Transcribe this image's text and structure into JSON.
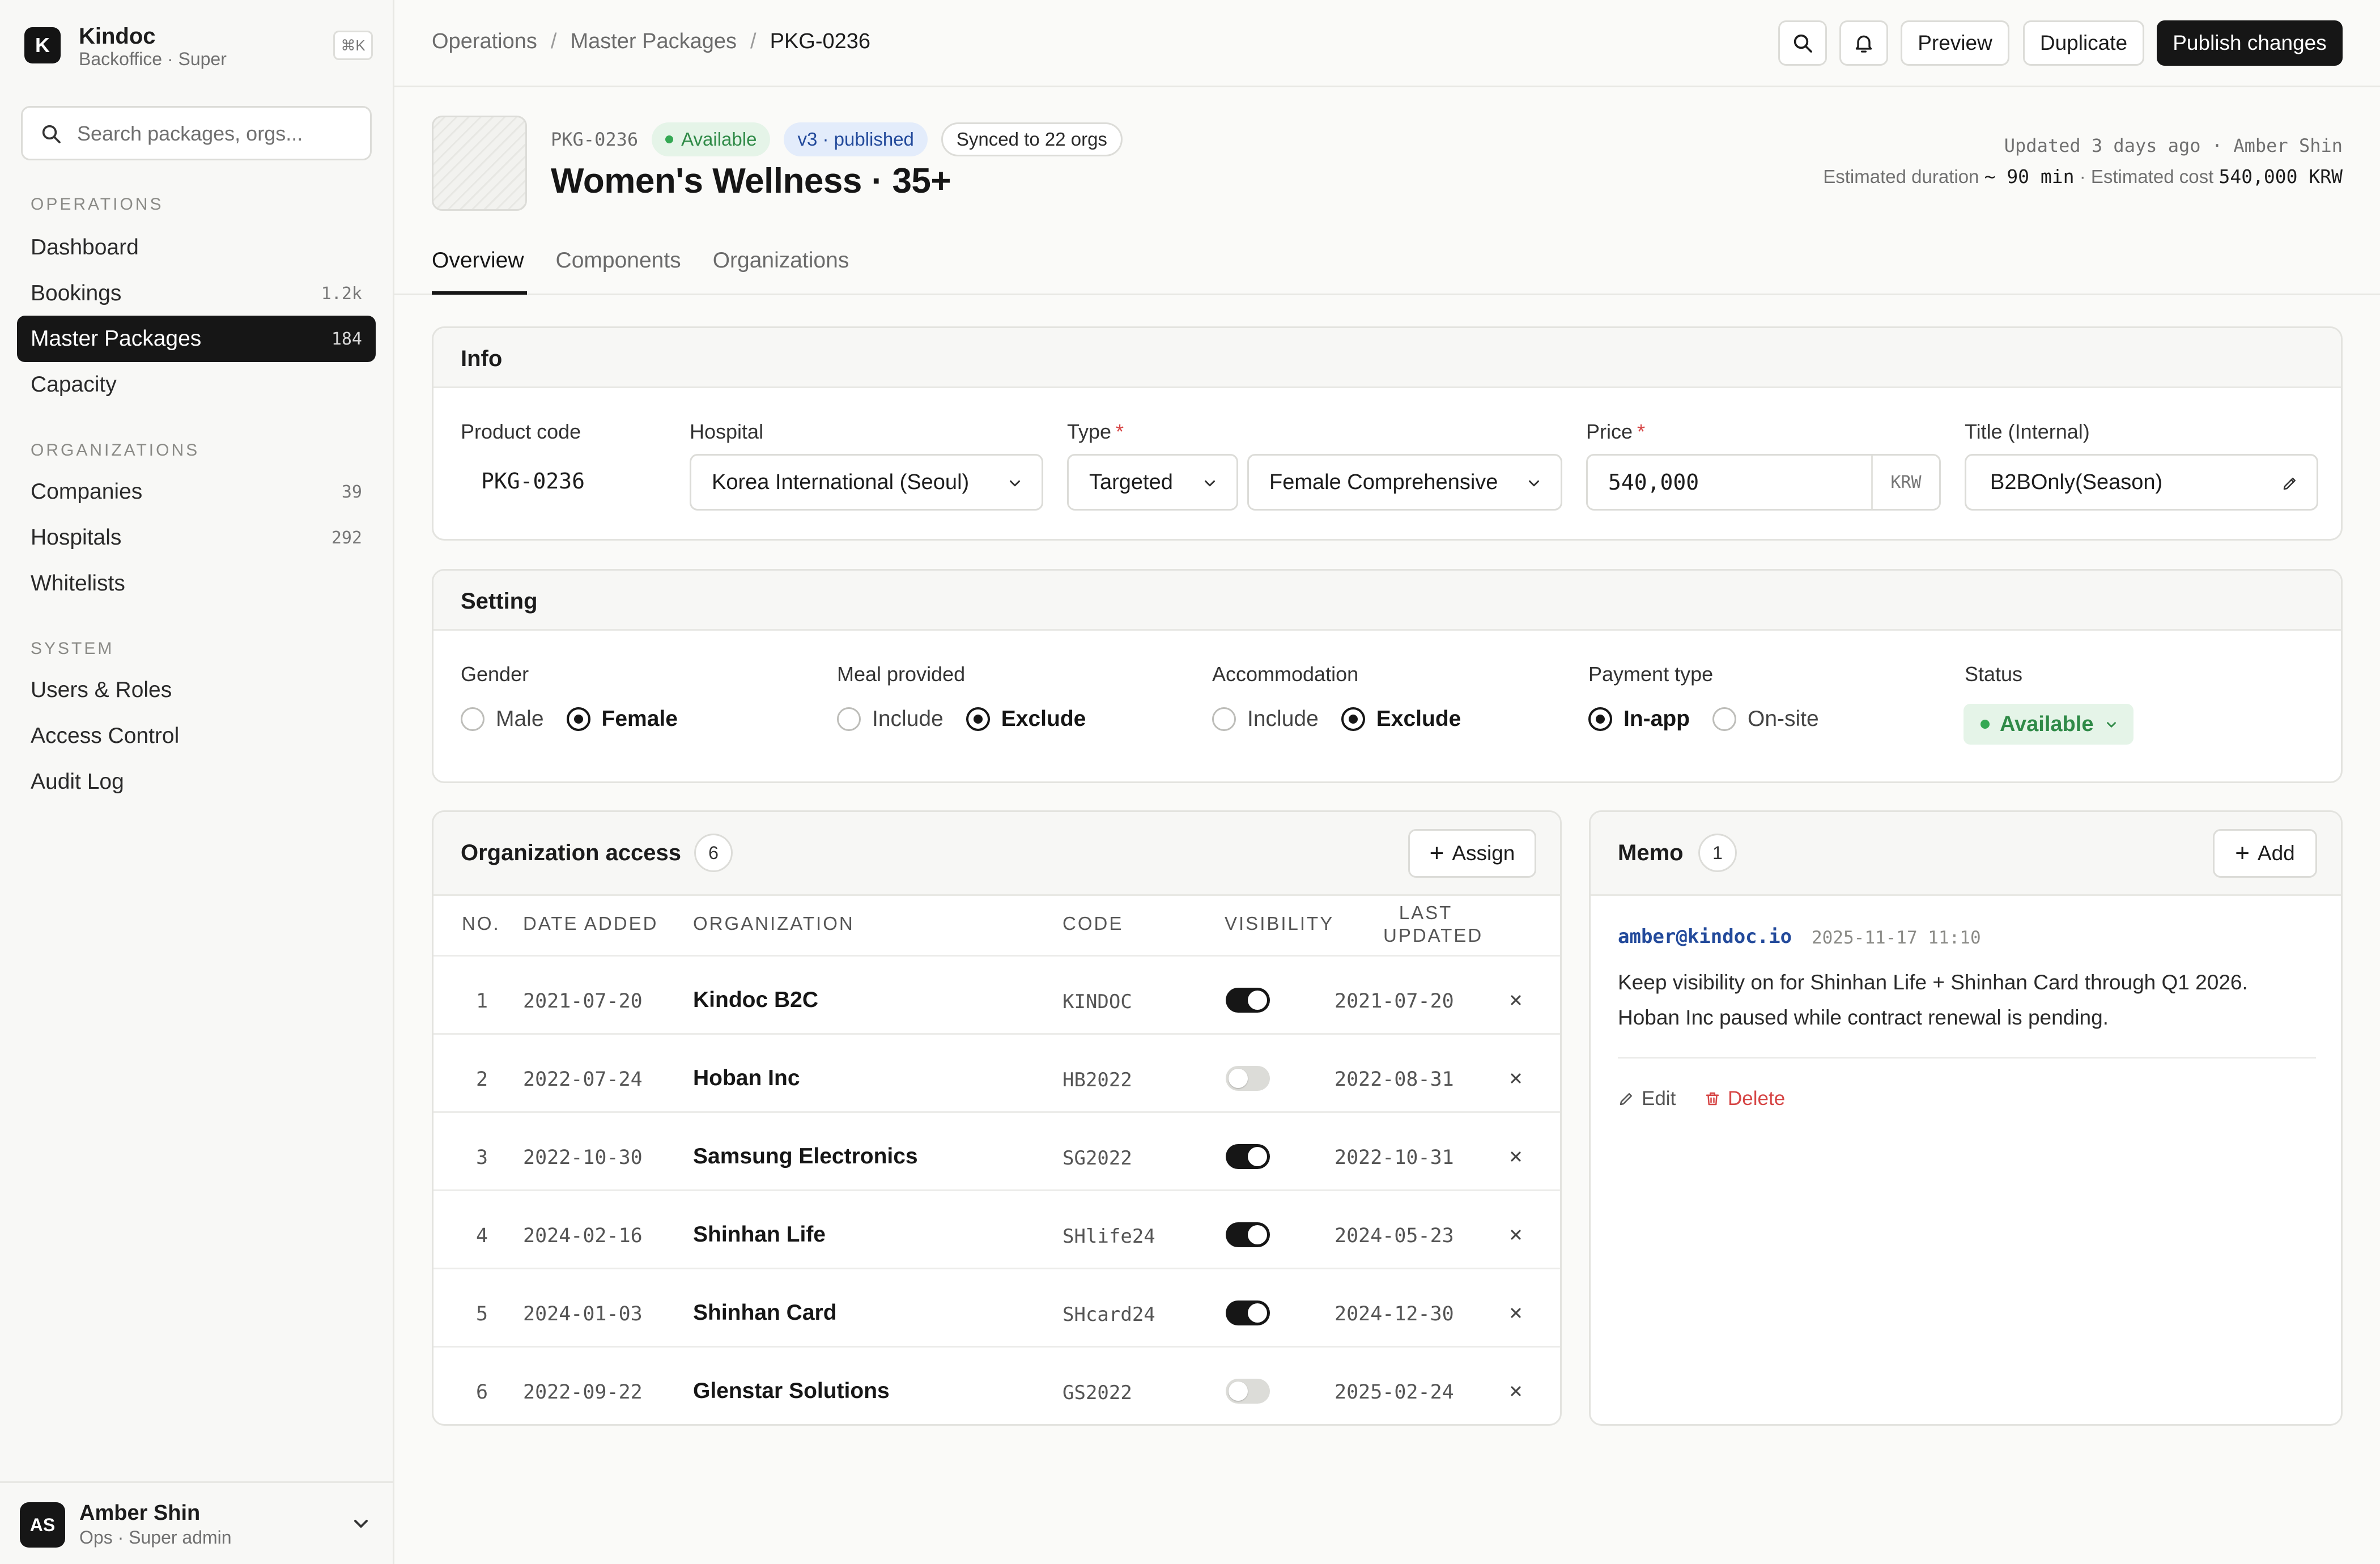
{
  "brand": {
    "name": "Kindoc",
    "subtitle": "Backoffice · Super",
    "logo_letter": "K",
    "shortcut": "⌘K"
  },
  "sidebar": {
    "search_placeholder": "Search packages, orgs...",
    "sections": [
      {
        "title": "OPERATIONS",
        "items": [
          {
            "label": "Dashboard",
            "count": ""
          },
          {
            "label": "Bookings",
            "count": "1.2k"
          },
          {
            "label": "Master Packages",
            "count": "184",
            "active": true
          },
          {
            "label": "Capacity",
            "count": ""
          }
        ]
      },
      {
        "title": "ORGANIZATIONS",
        "items": [
          {
            "label": "Companies",
            "count": "39"
          },
          {
            "label": "Hospitals",
            "count": "292"
          },
          {
            "label": "Whitelists",
            "count": ""
          }
        ]
      },
      {
        "title": "SYSTEM",
        "items": [
          {
            "label": "Users & Roles",
            "count": ""
          },
          {
            "label": "Access Control",
            "count": ""
          },
          {
            "label": "Audit Log",
            "count": ""
          }
        ]
      }
    ],
    "user": {
      "initials": "AS",
      "name": "Amber Shin",
      "role": "Ops · Super admin"
    }
  },
  "topbar": {
    "breadcrumb": [
      "Operations",
      "Master Packages",
      "PKG-0236"
    ],
    "preview_label": "Preview",
    "duplicate_label": "Duplicate",
    "publish_label": "Publish changes"
  },
  "header": {
    "code": "PKG-0236",
    "status_badge": "Available",
    "version_badge": "v3 · published",
    "sync_badge": "Synced to 22 orgs",
    "title": "Women's Wellness · 35+",
    "updated": "Updated 3 days ago · Amber Shin",
    "duration_label": "Estimated duration",
    "duration_value": "~ 90 min",
    "cost_label": "· Estimated cost",
    "cost_value": "540,000 KRW"
  },
  "tabs": [
    "Overview",
    "Components",
    "Organizations"
  ],
  "info": {
    "title": "Info",
    "product_code_label": "Product code",
    "product_code": "PKG-0236",
    "hospital_label": "Hospital",
    "hospital": "Korea International (Seoul)",
    "type_label": "Type",
    "type": "Targeted",
    "subtype": "Female Comprehensive",
    "price_label": "Price",
    "price": "540,000",
    "currency": "KRW",
    "title_internal_label": "Title (Internal)",
    "title_internal": "B2BOnly(Season)"
  },
  "setting": {
    "title": "Setting",
    "gender": {
      "label": "Gender",
      "options": [
        "Male",
        "Female"
      ],
      "selected": "Female"
    },
    "meal": {
      "label": "Meal provided",
      "options": [
        "Include",
        "Exclude"
      ],
      "selected": "Exclude"
    },
    "accommodation": {
      "label": "Accommodation",
      "options": [
        "Include",
        "Exclude"
      ],
      "selected": "Exclude"
    },
    "payment": {
      "label": "Payment type",
      "options": [
        "In-app",
        "On-site"
      ],
      "selected": "In-app"
    },
    "status": {
      "label": "Status",
      "value": "Available"
    }
  },
  "org_access": {
    "title": "Organization access",
    "count": "6",
    "assign_label": "Assign",
    "columns": {
      "no": "NO.",
      "date_added": "DATE ADDED",
      "organization": "ORGANIZATION",
      "code": "CODE",
      "visibility": "VISIBILITY",
      "last_updated_1": "LAST",
      "last_updated_2": "UPDATED"
    },
    "rows": [
      {
        "no": "1",
        "date_added": "2021-07-20",
        "organization": "Kindoc B2C",
        "code": "KINDOC",
        "visible": true,
        "last_updated": "2021-07-20"
      },
      {
        "no": "2",
        "date_added": "2022-07-24",
        "organization": "Hoban Inc",
        "code": "HB2022",
        "visible": false,
        "last_updated": "2022-08-31"
      },
      {
        "no": "3",
        "date_added": "2022-10-30",
        "organization": "Samsung Electronics",
        "code": "SG2022",
        "visible": true,
        "last_updated": "2022-10-31"
      },
      {
        "no": "4",
        "date_added": "2024-02-16",
        "organization": "Shinhan Life",
        "code": "SHlife24",
        "visible": true,
        "last_updated": "2024-05-23"
      },
      {
        "no": "5",
        "date_added": "2024-01-03",
        "organization": "Shinhan Card",
        "code": "SHcard24",
        "visible": true,
        "last_updated": "2024-12-30"
      },
      {
        "no": "6",
        "date_added": "2022-09-22",
        "organization": "Glenstar Solutions",
        "code": "GS2022",
        "visible": false,
        "last_updated": "2025-02-24"
      }
    ]
  },
  "memo": {
    "title": "Memo",
    "count": "1",
    "add_label": "Add",
    "author": "amber@kindoc.io",
    "time": "2025-11-17 11:10",
    "body_line1": "Keep visibility on for Shinhan Life + Shinhan Card through Q1 2026.",
    "body_line2": "Hoban Inc paused while contract renewal is pending.",
    "edit_label": "Edit",
    "delete_label": "Delete"
  },
  "colors": {
    "accent": "#161616",
    "success": "#2f8a47",
    "link": "#234a9b",
    "danger": "#d64545"
  }
}
